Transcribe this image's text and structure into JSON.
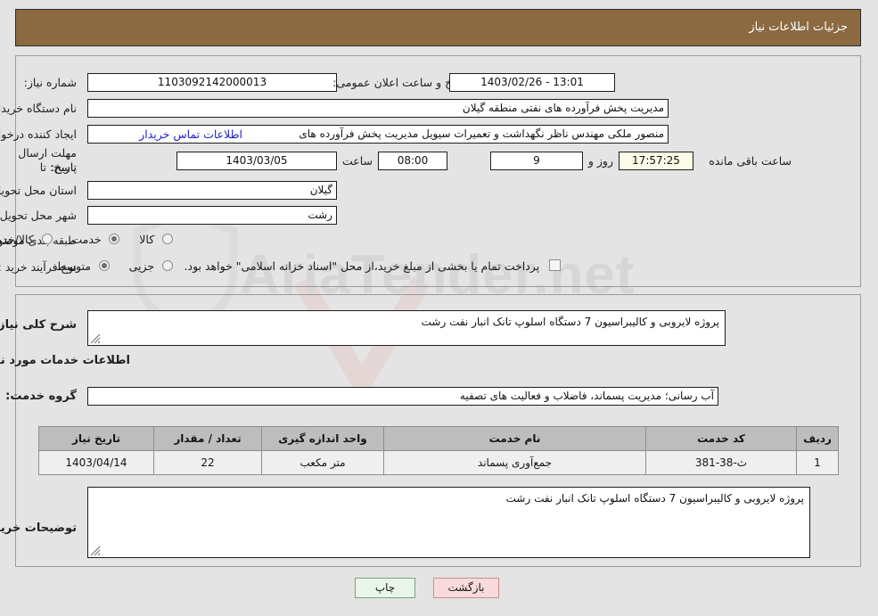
{
  "header": {
    "title": "جزئیات اطلاعات نیاز"
  },
  "watermark": {
    "text": "AriaTender.net"
  },
  "need_info": {
    "need_number_label": "شماره نیاز:",
    "need_number_value": "1103092142000013",
    "public_announce_label": "تاریخ و ساعت اعلان عمومی:",
    "public_announce_value": "13:01 - 1403/02/26",
    "buyer_org_label": "نام دستگاه خریدار:",
    "buyer_org_value": "مدیریت پخش فرآورده های نفتی منطقه گیلان",
    "requester_label": "ایجاد کننده درخواست:",
    "requester_value": "منصور ملکی مهندس ناظر نگهداشت و تعمیرات سیویل مدیریت پخش فرآورده های",
    "contact_link": "اطلاعات تماس خریدار",
    "deadline_label_line1": "مهلت ارسال پاسخ: تا",
    "deadline_label_line2": "تاریخ:",
    "deadline_date": "1403/03/05",
    "deadline_hour_label": "ساعت",
    "deadline_hour_value": "08:00",
    "remaining_days_value": "9",
    "remaining_days_label": "روز و",
    "remaining_time_value": "17:57:25",
    "remaining_time_label": "ساعت باقی مانده",
    "province_label": "استان محل تحویل:",
    "province_value": "گیلان",
    "city_label": "شهر محل تحویل:",
    "city_value": "رشت",
    "category_label": "طبقه بندی موضوعی:",
    "category_options": [
      {
        "label": "کالا",
        "selected": false
      },
      {
        "label": "خدمت",
        "selected": true
      },
      {
        "label": "کالا/خدمت",
        "selected": false
      }
    ],
    "process_label": "نوع فرآیند خرید :",
    "process_options": [
      {
        "label": "جزیی",
        "selected": false
      },
      {
        "label": "متوسط",
        "selected": true
      }
    ],
    "treasury_checkbox_label": "پرداخت تمام یا بخشی از مبلغ خرید،از محل \"اسناد خزانه اسلامی\" خواهد بود.",
    "treasury_checked": false
  },
  "summary": {
    "label": "شرح کلی نیاز:",
    "value": "پروژه لایروبی و کالیبراسیون 7 دستگاه اسلوپ تانک انبار نفت رشت"
  },
  "services_section": {
    "heading": "اطلاعات خدمات مورد نیاز",
    "group_label": "گروه خدمت:",
    "group_value": "آب رسانی؛ مدیریت پسماند، فاضلاب و فعالیت های تصفیه",
    "table": {
      "columns": [
        "ردیف",
        "کد خدمت",
        "نام خدمت",
        "واحد اندازه گیری",
        "تعداد / مقدار",
        "تاریخ نیاز"
      ],
      "rows": [
        {
          "row_no": "1",
          "service_code": "ث-38-381",
          "service_name": "جمع‌آوری پسماند",
          "unit": "متر مکعب",
          "quantity": "22",
          "need_date": "1403/04/14"
        }
      ]
    }
  },
  "buyer_comments": {
    "label": "توضیحات خریدار:",
    "value": "پروژه لایروبی و کالیبراسیون 7 دستگاه اسلوپ تانک انبار نفت رشت"
  },
  "footer": {
    "print_label": "چاپ",
    "back_label": "بازگشت"
  },
  "colors": {
    "header_bg": "#8b6a42",
    "link": "#2020cc",
    "print_btn_bg": "#e8f5e9",
    "back_btn_bg": "#fadbdb",
    "table_header_bg": "#bdbdbd",
    "countdown_bg": "#fbfbe7"
  }
}
